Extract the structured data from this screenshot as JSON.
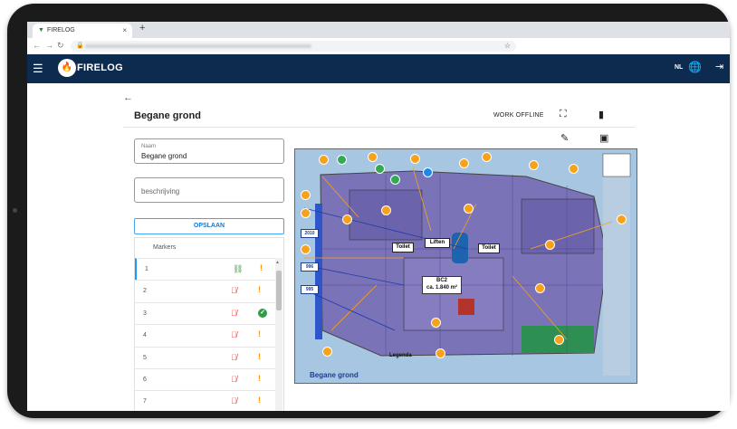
{
  "browser": {
    "tab_title": "FIRELOG",
    "tab_close": "×",
    "new_tab": "+",
    "back": "←",
    "forward": "→",
    "reload": "↻",
    "star": "☆"
  },
  "appbar": {
    "brand": "FIRELOG",
    "lang": "NL",
    "colors": {
      "bar": "#0d2b4e"
    }
  },
  "page": {
    "title": "Begane grond",
    "work_offline": "WORK OFFLINE"
  },
  "form": {
    "name_label": "Naam",
    "name_value": "Begane grond",
    "description_placeholder": "beschrijving",
    "save_label": "OPSLAAN"
  },
  "markers": {
    "header": "Markers",
    "items": [
      {
        "number": "1",
        "linked": true,
        "status": "warning"
      },
      {
        "number": "2",
        "linked": false,
        "status": "warning"
      },
      {
        "number": "3",
        "linked": false,
        "status": "done"
      },
      {
        "number": "4",
        "linked": false,
        "status": "warning"
      },
      {
        "number": "5",
        "linked": false,
        "status": "warning"
      },
      {
        "number": "6",
        "linked": false,
        "status": "warning"
      },
      {
        "number": "7",
        "linked": false,
        "status": "warning"
      }
    ]
  },
  "plan": {
    "title": "Begane grond",
    "rooms": {
      "bc2": "BC2",
      "area": "ca. 1.840 m²",
      "toilet_left": "Toilet",
      "toilet_right": "Toilet",
      "lift": "Liften"
    },
    "side_labels": [
      "2010",
      "996",
      "995"
    ],
    "legend_title": "Legenda"
  }
}
